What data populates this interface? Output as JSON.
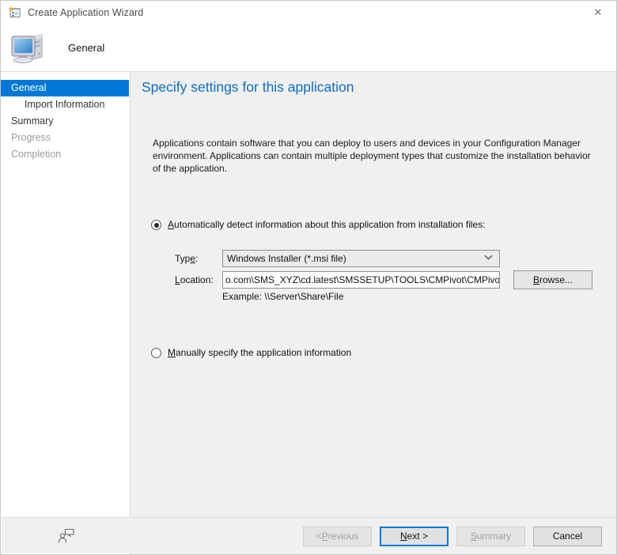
{
  "window": {
    "title": "Create Application Wizard",
    "title_icon": "wizard-window-icon",
    "close_label": "✕"
  },
  "banner": {
    "icon": "computer-icon",
    "title": "General"
  },
  "sidebar": {
    "items": [
      {
        "label": "General",
        "state": "selected",
        "sub": false
      },
      {
        "label": "Import Information",
        "state": "normal",
        "sub": true
      },
      {
        "label": "Summary",
        "state": "normal",
        "sub": false
      },
      {
        "label": "Progress",
        "state": "disabled",
        "sub": false
      },
      {
        "label": "Completion",
        "state": "disabled",
        "sub": false
      }
    ]
  },
  "page": {
    "heading": "Specify settings for this application",
    "intro_line1": "Applications contain software that you can deploy to users and devices in your Configuration Manager environment.",
    "intro_line2": "Applications can contain multiple deployment types that customize the installation behavior of the application."
  },
  "options": {
    "auto": {
      "label_accesskey": "A",
      "label_rest": "utomatically detect information about this application from installation files:",
      "checked": true
    },
    "manual": {
      "label_accesskey": "M",
      "label_rest": "anually specify the application information",
      "checked": false
    }
  },
  "fields": {
    "type": {
      "label": "Typ",
      "label_accesskey": "e",
      "label_suffix": ":",
      "value": "Windows Installer (*.msi file)",
      "chevron": "⌄"
    },
    "location": {
      "label_accesskey": "L",
      "label_rest": "ocation:",
      "value": "o.com\\SMS_XYZ\\cd.latest\\SMSSETUP\\TOOLS\\CMPivot\\CMPivot.msi",
      "placeholder": "",
      "example": "Example: \\\\Server\\Share\\File"
    },
    "browse": {
      "accesskey": "B",
      "rest": "rowse..."
    }
  },
  "footer": {
    "feedback_icon": "feedback-person-icon",
    "buttons": [
      {
        "label": "< Previous",
        "prefix": "< ",
        "accesskey": "P",
        "rest": "revious",
        "state": "disabled"
      },
      {
        "label": "Next >",
        "prefix": "",
        "accesskey": "N",
        "rest": "ext >",
        "state": "default"
      },
      {
        "label": "Summary",
        "prefix": "",
        "accesskey": "S",
        "rest": "ummary",
        "state": "disabled"
      },
      {
        "label": "Cancel",
        "prefix": "",
        "accesskey": "",
        "rest": "Cancel",
        "state": "normal"
      }
    ]
  },
  "colors": {
    "accent": "#0078d7",
    "heading": "#0a6cc4",
    "content_bg": "#f0f0f0",
    "sidebar_bg": "#ffffff"
  }
}
